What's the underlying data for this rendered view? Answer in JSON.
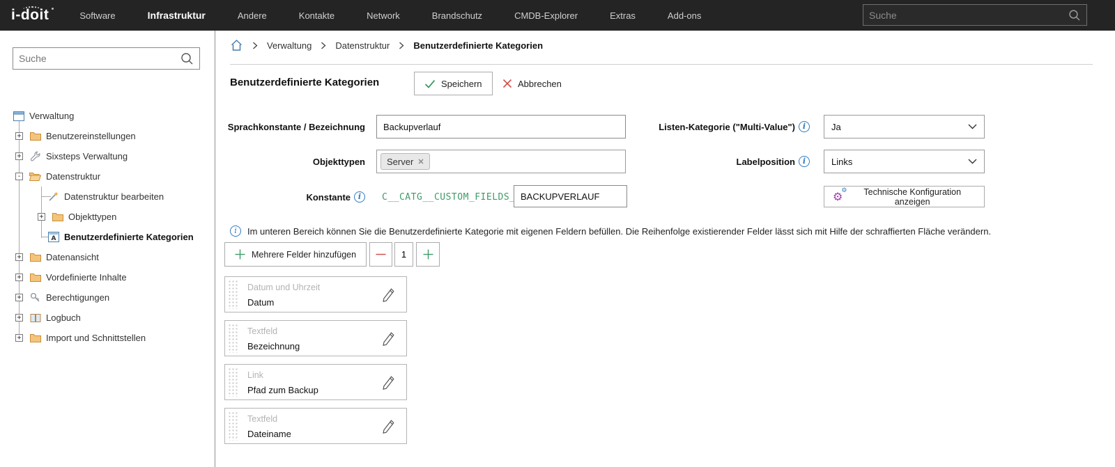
{
  "topbar": {
    "logo": "i-doit",
    "menu": [
      {
        "label": "Software"
      },
      {
        "label": "Infrastruktur"
      },
      {
        "label": "Andere"
      },
      {
        "label": "Kontakte"
      },
      {
        "label": "Network"
      },
      {
        "label": "Brandschutz"
      },
      {
        "label": "CMDB-Explorer"
      },
      {
        "label": "Extras"
      },
      {
        "label": "Add-ons"
      }
    ],
    "search": {
      "placeholder": "Suche"
    }
  },
  "sidebar": {
    "search": {
      "placeholder": "Suche"
    },
    "tree": {
      "root": {
        "label": "Verwaltung",
        "icon": "window-icon"
      },
      "items": [
        {
          "label": "Benutzereinstellungen",
          "icon": "folder-icon",
          "expander": "+"
        },
        {
          "label": "Sixsteps Verwaltung",
          "icon": "wrench-icon",
          "expander": "+"
        },
        {
          "label": "Datenstruktur",
          "icon": "folder-open-icon",
          "expander": "-"
        },
        {
          "label": "Datenstruktur bearbeiten",
          "icon": "wand-icon",
          "expander": ""
        },
        {
          "label": "Objekttypen",
          "icon": "folder-icon",
          "expander": "+"
        },
        {
          "label": "Benutzerdefinierte Kategorien",
          "icon": "text-a-icon",
          "expander": "",
          "selected": true
        },
        {
          "label": "Datenansicht",
          "icon": "folder-icon",
          "expander": "+"
        },
        {
          "label": "Vordefinierte Inhalte",
          "icon": "folder-icon",
          "expander": "+"
        },
        {
          "label": "Berechtigungen",
          "icon": "key-icon",
          "expander": "+"
        },
        {
          "label": "Logbuch",
          "icon": "book-icon",
          "expander": "+"
        },
        {
          "label": "Import und Schnittstellen",
          "icon": "folder-icon",
          "expander": "+"
        }
      ]
    }
  },
  "breadcrumb": {
    "home_icon": "home-icon",
    "items": [
      {
        "label": "Verwaltung"
      },
      {
        "label": "Datenstruktur"
      },
      {
        "label": "Benutzerdefinierte Kategorien"
      }
    ]
  },
  "page": {
    "title": "Benutzerdefinierte Kategorien",
    "save_label": "Speichern",
    "cancel_label": "Abbrechen"
  },
  "form": {
    "sprachkonstante": {
      "label": "Sprachkonstante / Bezeichnung",
      "value": "Backupverlauf"
    },
    "listen_kategorie": {
      "label": "Listen-Kategorie (\"Multi-Value\")",
      "value": "Ja",
      "has_info": true
    },
    "objekttypen": {
      "label": "Objekttypen",
      "tag": "Server"
    },
    "labelposition": {
      "label": "Labelposition",
      "value": "Links",
      "has_info": true
    },
    "konstante": {
      "label": "Konstante",
      "prefix": "C__CATG__CUSTOM_FIELDS_",
      "value": "BACKUPVERLAUF",
      "has_info": true
    },
    "tech_config_label": "Technische Konfiguration anzeigen"
  },
  "fields_section": {
    "info_text": "Im unteren Bereich können Sie die Benutzerdefinierte Kategorie mit eigenen Feldern befüllen. Die Reihenfolge existierender Felder lässt sich mit Hilfe der schraffierten Fläche verändern.",
    "add_multiple_label": "Mehrere Felder hinzufügen",
    "count_value": "1",
    "fields": [
      {
        "type": "Datum und Uhrzeit",
        "name": "Datum"
      },
      {
        "type": "Textfeld",
        "name": "Bezeichnung"
      },
      {
        "type": "Link",
        "name": "Pfad zum Backup"
      },
      {
        "type": "Textfeld",
        "name": "Dateiname"
      }
    ]
  },
  "colors": {
    "topbar_bg": "#242424",
    "accent_green": "#3f9b68",
    "accent_red": "#d0514b",
    "folder_orange": "#f2c179",
    "info_blue": "#2f7bbf",
    "gear_purple": "#a43fb5",
    "const_green": "#3f9b68"
  },
  "icons": {
    "gear_glyph": "⚙"
  }
}
